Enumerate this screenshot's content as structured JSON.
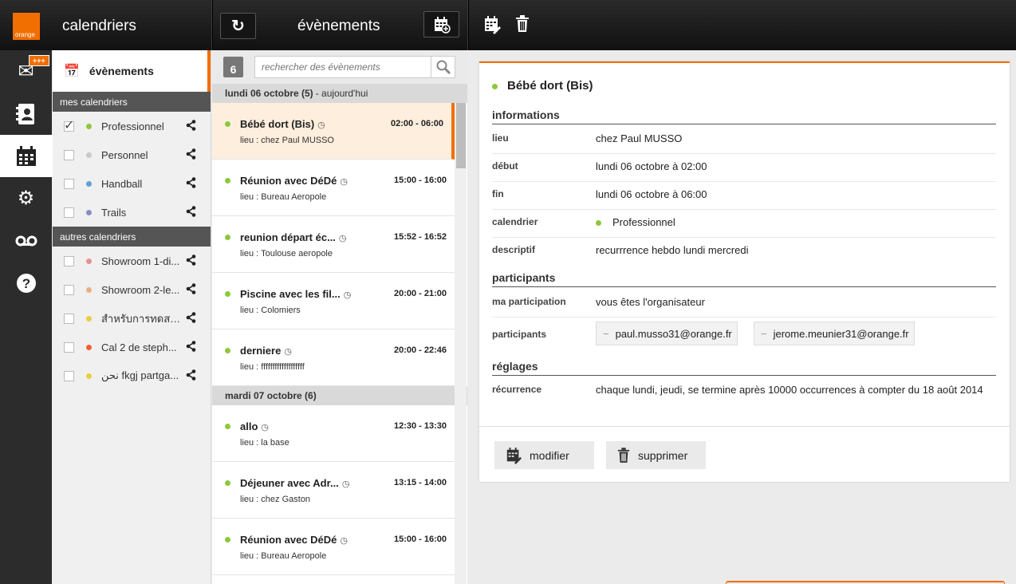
{
  "brand": {
    "logo_text": "orange",
    "accent": "#f16e00"
  },
  "header": {
    "app_title": "calendriers",
    "events_title": "évènements",
    "refresh_icon": "refresh-icon",
    "add_event_icon": "calendar-add-icon",
    "edit_icon": "calendar-edit-icon",
    "delete_icon": "trash-icon"
  },
  "leftnav": {
    "mail_badge": "+++",
    "items": [
      "mail-icon",
      "contacts-icon",
      "calendar-icon",
      "settings-icon",
      "voicemail-icon",
      "help-icon"
    ]
  },
  "calendars": {
    "events_label": "évènements",
    "my_section": "mes calendriers",
    "my": [
      {
        "name": "Professionnel",
        "checked": true,
        "color": "#8cc83c"
      },
      {
        "name": "Personnel",
        "checked": false,
        "color": "#c8c8c8"
      },
      {
        "name": "Handball",
        "checked": false,
        "color": "#5fa0d8"
      },
      {
        "name": "Trails",
        "checked": false,
        "color": "#8c8cc8"
      }
    ],
    "other_section": "autres calendriers",
    "other": [
      {
        "name": "Showroom 1-di...",
        "checked": false,
        "color": "#e89090"
      },
      {
        "name": "Showroom 2-le...",
        "checked": false,
        "color": "#e8b080"
      },
      {
        "name": "สำหรับการทดสอบ...",
        "checked": false,
        "color": "#e8d040"
      },
      {
        "name": "Cal 2 de steph...",
        "checked": false,
        "color": "#f06030"
      },
      {
        "name": "نحن fkgj partga...",
        "checked": false,
        "color": "#e8d040"
      }
    ]
  },
  "eventlist": {
    "date_badge": "6",
    "search_placeholder": "rechercher des évènements",
    "days": [
      {
        "label": "lundi 06 octobre (5)",
        "sub": "- aujourd'hui",
        "events": [
          {
            "title": "Bébé dort (Bis)",
            "time": "02:00 - 06:00",
            "location": "lieu : chez Paul MUSSO",
            "selected": true
          },
          {
            "title": "Réunion avec DéDé",
            "time": "15:00 - 16:00",
            "location": "lieu : Bureau Aeropole",
            "selected": false
          },
          {
            "title": "reunion départ éc...",
            "time": "15:52 - 16:52",
            "location": "lieu : Toulouse aeropole",
            "selected": false
          },
          {
            "title": "Piscine avec les fil...",
            "time": "20:00 - 21:00",
            "location": "lieu : Colomiers",
            "selected": false
          },
          {
            "title": "derniere",
            "time": "20:00 - 22:46",
            "location": "lieu : fffffffffffffffffff",
            "selected": false
          }
        ]
      },
      {
        "label": "mardi 07 octobre (6)",
        "sub": "",
        "events": [
          {
            "title": "allo",
            "time": "12:30 - 13:30",
            "location": "lieu : la base",
            "selected": false
          },
          {
            "title": "Déjeuner avec Adr...",
            "time": "13:15 - 14:00",
            "location": "lieu : chez Gaston",
            "selected": false
          },
          {
            "title": "Réunion avec DéDé",
            "time": "15:00 - 16:00",
            "location": "lieu : Bureau Aeropole",
            "selected": false
          }
        ]
      }
    ]
  },
  "detail": {
    "title": "Bébé dort (Bis)",
    "info_section": "informations",
    "lieu_label": "lieu",
    "lieu": "chez Paul MUSSO",
    "debut_label": "début",
    "debut": "lundi 06 octobre à 02:00",
    "fin_label": "fin",
    "fin": "lundi 06 octobre à 06:00",
    "calendrier_label": "calendrier",
    "calendrier": "Professionnel",
    "descriptif_label": "descriptif",
    "descriptif": "recurrrence hebdo lundi mercredi",
    "participants_section": "participants",
    "ma_participation_label": "ma participation",
    "ma_participation": "vous êtes l'organisateur",
    "participants_label": "participants",
    "participants": [
      "paul.musso31@orange.fr",
      "jerome.meunier31@orange.fr"
    ],
    "reglages_section": "réglages",
    "recurrence_label": "récurrence",
    "recurrence": "chaque lundi, jeudi, se termine après 10000 occurrences à compter du 18 août 2014",
    "modify_label": "modifier",
    "delete_label": "supprimer"
  }
}
